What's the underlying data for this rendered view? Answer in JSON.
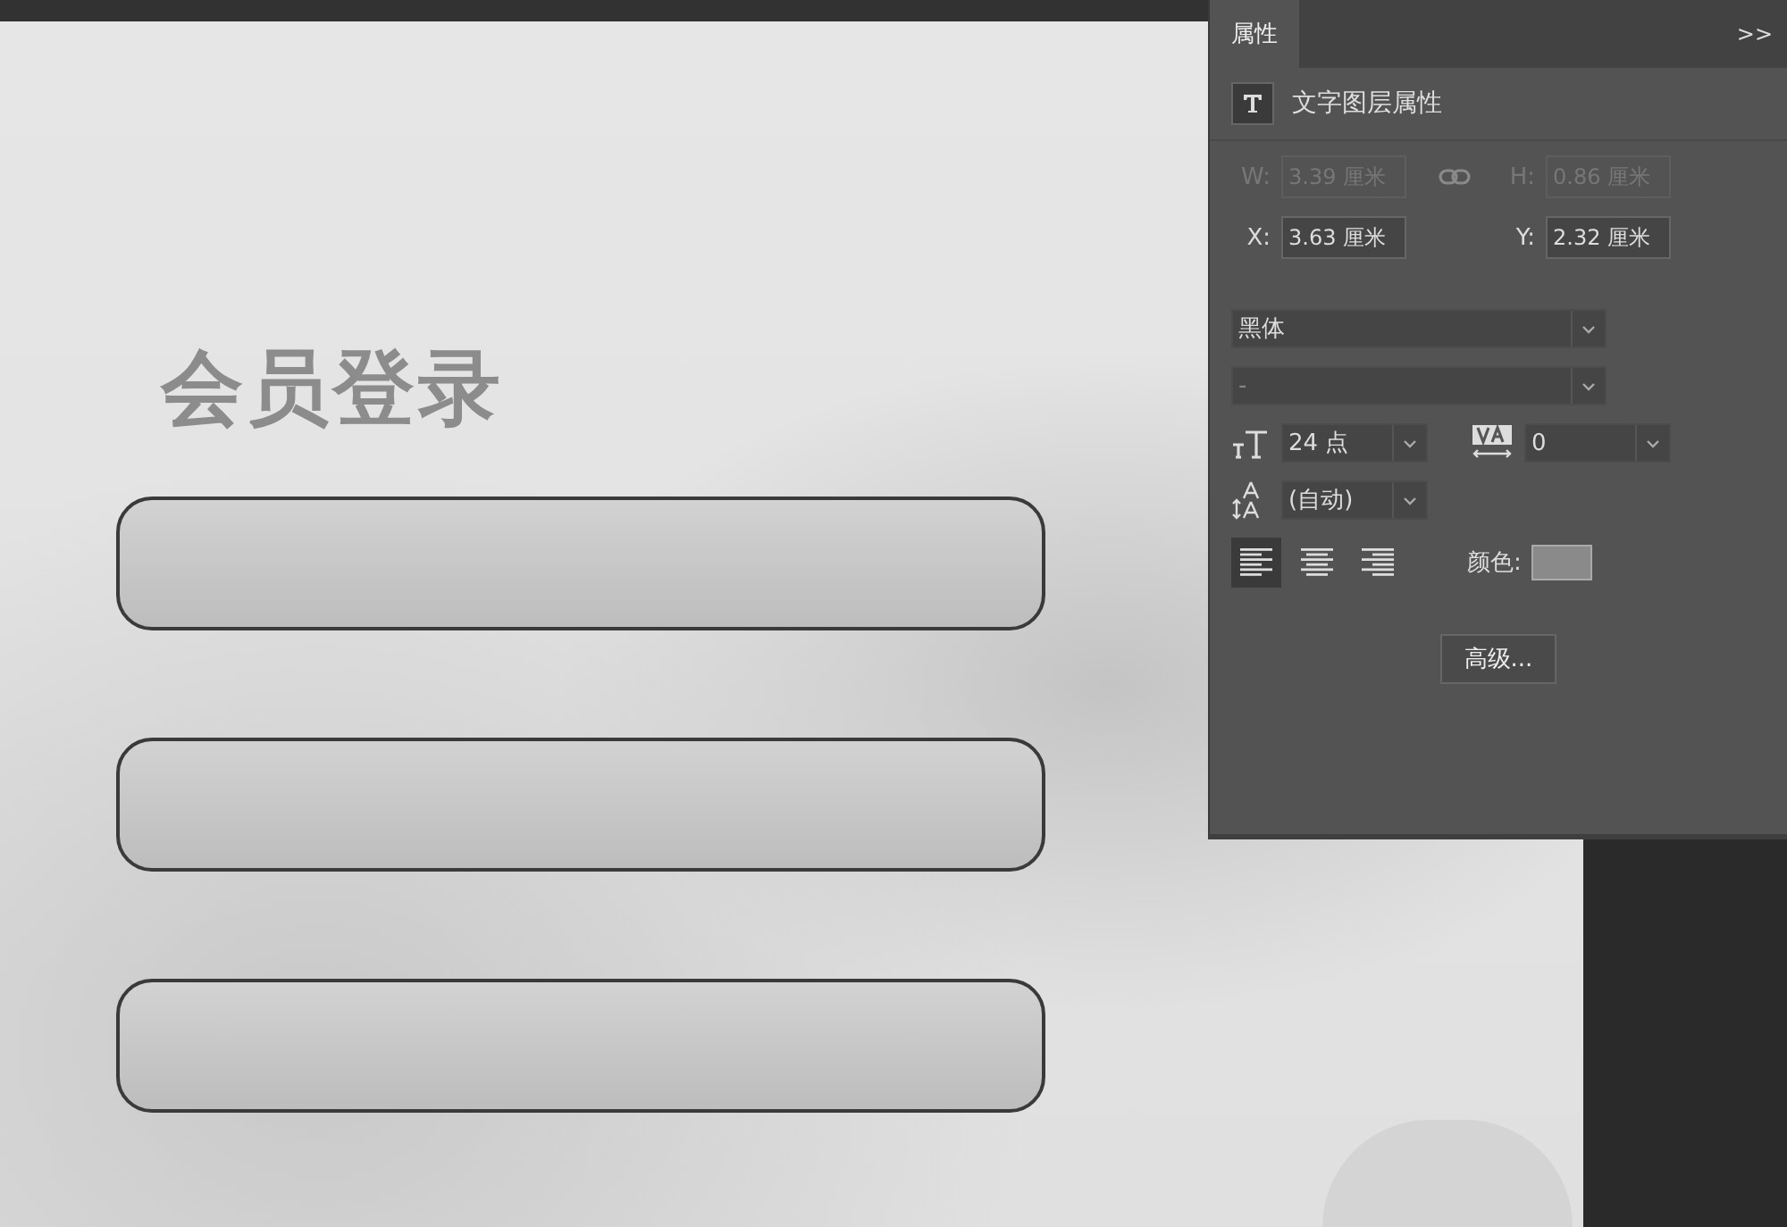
{
  "canvas": {
    "title": "会员登录",
    "fields": [
      {
        "kind": "empty"
      },
      {
        "kind": "empty"
      },
      {
        "kind": "empty"
      }
    ]
  },
  "properties_panel": {
    "tab": {
      "label": "属性",
      "selected": true
    },
    "collapse": ">>",
    "section_title": "文字图层属性",
    "size": [
      {
        "label": "W:",
        "value": "3.39 厘米",
        "disabled": true
      },
      {
        "label": "H:",
        "value": "0.86 厘米",
        "disabled": true
      }
    ],
    "position": [
      {
        "label": "X:",
        "value": "3.63 厘米",
        "disabled": false
      },
      {
        "label": "Y:",
        "value": "2.32 厘米",
        "disabled": false
      }
    ],
    "font_family": "黑体",
    "font_style": "-",
    "font_size": "24 点",
    "tracking": "0",
    "leading": "(自动)",
    "alignment": [
      {
        "kind": "left",
        "selected": true
      },
      {
        "kind": "center",
        "selected": false
      },
      {
        "kind": "right",
        "selected": false
      }
    ],
    "color_label": "颜色:",
    "color": "#8a8a8a",
    "advanced_button": "高级..."
  }
}
